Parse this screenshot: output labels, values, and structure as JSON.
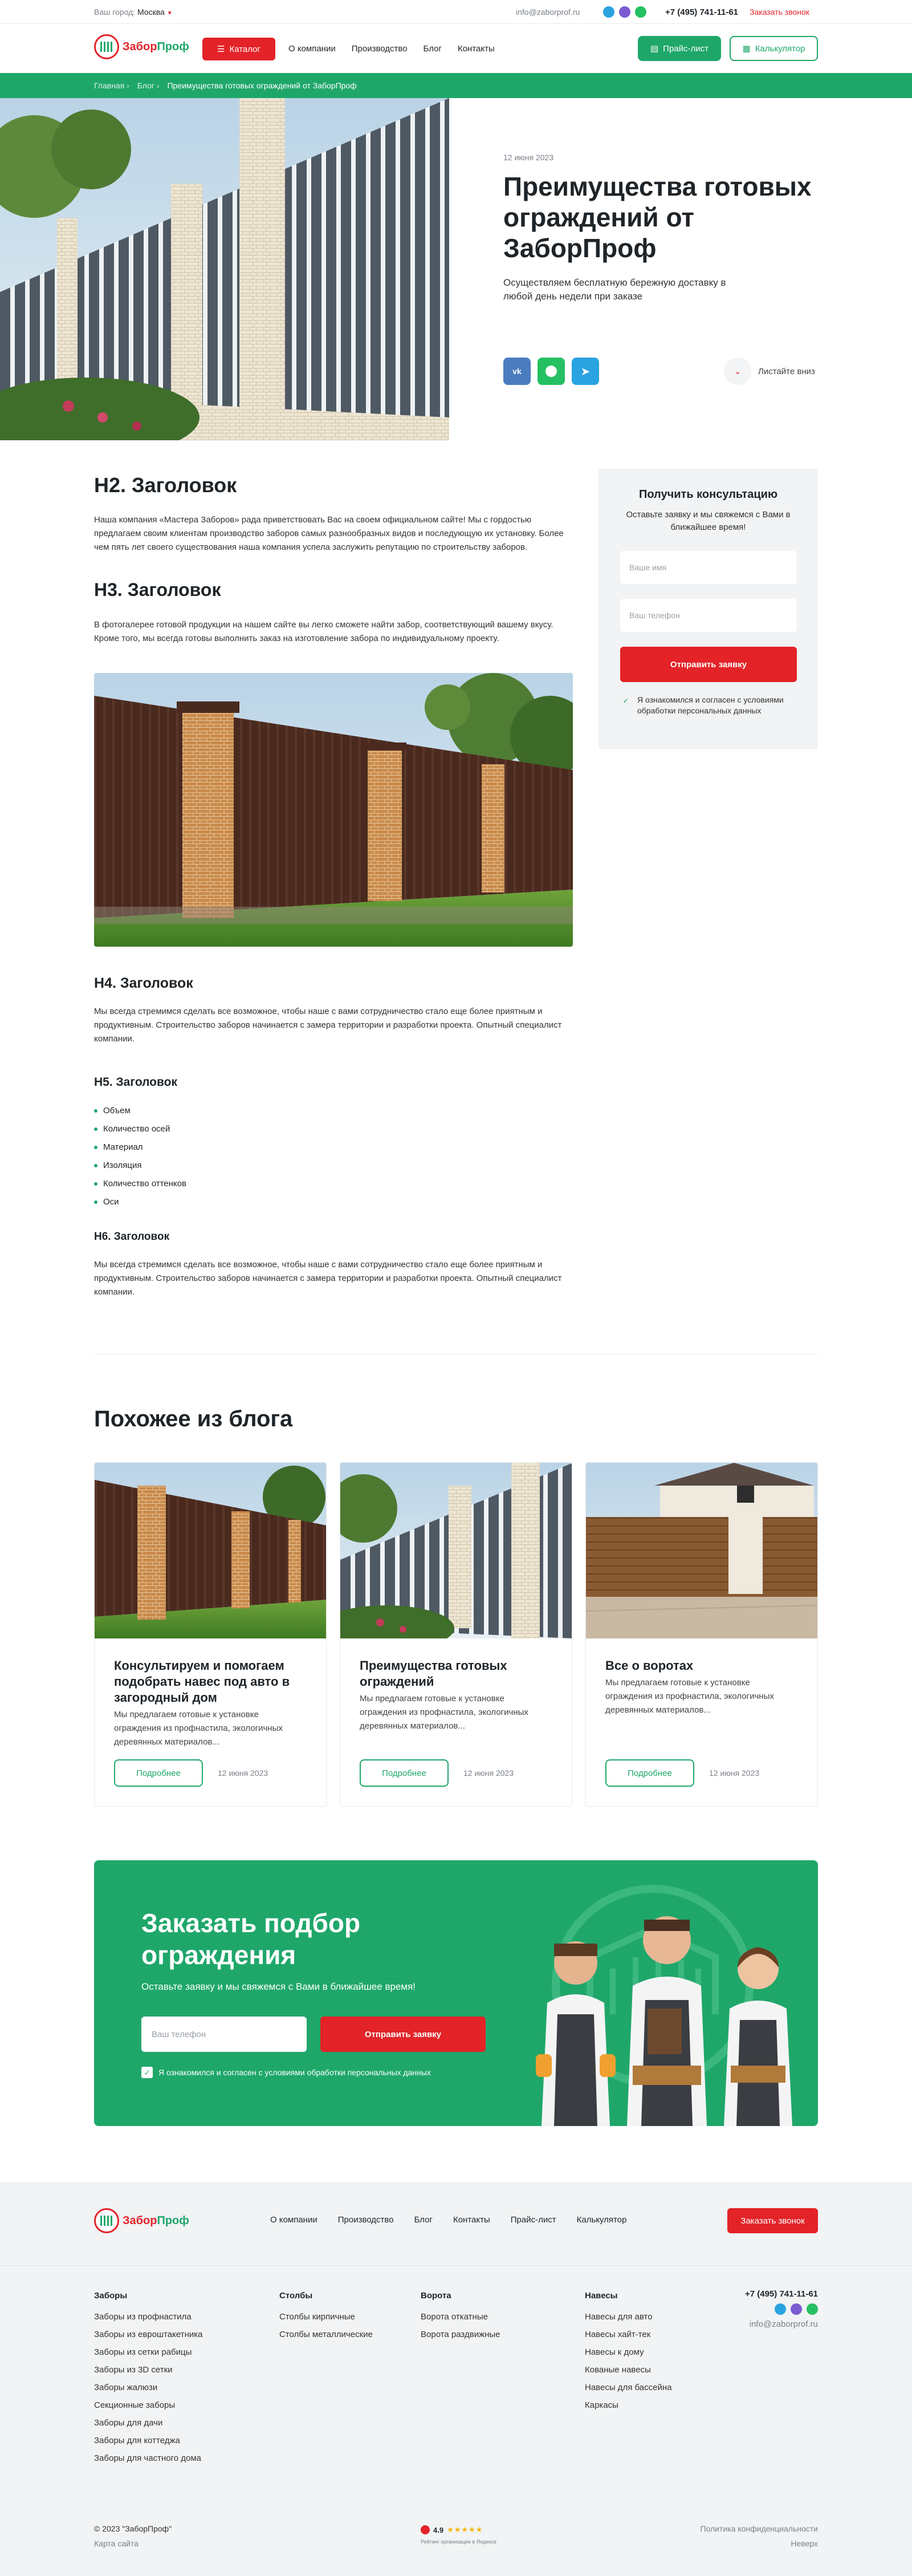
{
  "colors": {
    "brand_green": "#1fa76a",
    "brand_red": "#e32328",
    "footer_bg": "#f1f3f4"
  },
  "topbar": {
    "city_label": "Ваш город:",
    "city": "Москва",
    "email": "info@zaborprof.ru",
    "phone": "+7 (495) 741-11-61",
    "callback": "Заказать звонок"
  },
  "header": {
    "logo_a": "Забор",
    "logo_b": "Проф",
    "catalog": "Каталог",
    "nav": [
      "О компании",
      "Производство",
      "Блог",
      "Контакты"
    ],
    "price_list": "Прайс-лист",
    "calculator": "Калькулятор"
  },
  "breadcrumbs": [
    "Главная",
    "Блог",
    "Преимущества готовых ограждений от ЗаборПроф"
  ],
  "hero": {
    "date": "12 июня 2023",
    "title": "Преимущества готовых ограждений от ЗаборПроф",
    "subtitle": "Осуществляем бесплатную бережную доставку в любой день недели при заказе",
    "scroll": "Листайте вниз"
  },
  "article": {
    "h2": "H2. Заголовок",
    "p1": "Наша компания «Мастера Заборов» рада приветствовать Вас на своем официальном сайте! Мы с гордостью предлагаем своим клиентам производство заборов самых разнообразных видов и последующую их установку. Более чем пять лет своего существования наша компания успела заслужить репутацию по строительству заборов.",
    "h3": "H3. Заголовок",
    "p2": "В фотогалерее готовой продукции на нашем сайте вы легко сможете найти забор, соответствующий вашему вкусу. Кроме того, мы всегда готовы выполнить заказ на изготовление забора по индивидуальному проекту.",
    "h4": "H4. Заголовок",
    "p3": "Мы всегда стремимся сделать все возможное, чтобы наше с вами сотрудничество стало еще более приятным и продуктивным. Строительство заборов начинается с замера территории и разработки проекта. Опытный специалист компании.",
    "h5": "H5. Заголовок",
    "list": [
      "Объем",
      "Количество осей",
      "Материал",
      "Изоляция",
      "Количество оттенков",
      "Оси"
    ],
    "h6": "H6. Заголовок",
    "p4": "Мы всегда стремимся сделать все возможное, чтобы наше с вами сотрудничество стало еще более приятным и продуктивным. Строительство заборов начинается с замера территории и разработки проекта. Опытный специалист компании."
  },
  "consult": {
    "title": "Получить консультацию",
    "subtitle": "Оставьте заявку и мы свяжемся с Вами в ближайшее время!",
    "name_placeholder": "Ваше имя",
    "phone_placeholder": "Ваш телефон",
    "submit": "Отправить заявку",
    "consent": "Я ознакомился и согласен с условиями обработки персональных данных"
  },
  "blog": {
    "title": "Похожее из блога",
    "more": "Подробнее",
    "cards": [
      {
        "title": "Консультируем и помогаем подобрать навес под авто в загородный дом",
        "desc": "Мы предлагаем готовые к установке ограждения из профнастила, экологичных деревянных материалов...",
        "date": "12 июня 2023"
      },
      {
        "title": "Преимущества готовых ограждений",
        "desc": "Мы предлагаем готовые к установке ограждения из профнастила, экологичных деревянных материалов...",
        "date": "12 июня 2023"
      },
      {
        "title": "Все о воротах",
        "desc": "Мы предлагаем готовые к установке ограждения из профнастила, экологичных деревянных материалов...",
        "date": "12 июня 2023"
      }
    ]
  },
  "cta": {
    "title": "Заказать подбор ограждения",
    "subtitle": "Оставьте заявку и мы свяжемся с Вами в ближайшее время!",
    "phone_placeholder": "Ваш телефон",
    "submit": "Отправить заявку",
    "consent": "Я ознакомился и согласен с условиями обработки персональных данных"
  },
  "footer": {
    "nav": [
      "О компании",
      "Производство",
      "Блог",
      "Контакты",
      "Прайс-лист",
      "Калькулятор"
    ],
    "callback": "Заказать звонок",
    "cols": [
      {
        "title": "Заборы",
        "items": [
          "Заборы из профнастила",
          "Заборы из евроштакетника",
          "Заборы из сетки рабицы",
          "Заборы из 3D сетки",
          "Заборы жалюзи",
          "Секционные заборы",
          "Заборы для дачи",
          "Заборы для коттеджа",
          "Заборы для частного дома"
        ]
      },
      {
        "title": "Столбы",
        "items": [
          "Столбы кирпичные",
          "Столбы металлические"
        ]
      },
      {
        "title": "Ворота",
        "items": [
          "Ворота откатные",
          "Ворота раздвижные"
        ]
      },
      {
        "title": "Навесы",
        "items": [
          "Навесы для авто",
          "Навесы хайт-тек",
          "Навесы к дому",
          "Кованые навесы",
          "Навесы для бассейна",
          "Каркасы"
        ]
      }
    ],
    "phone": "+7 (495) 741-11-61",
    "email": "info@zaborprof.ru",
    "copyright": "© 2023 \"ЗаборПроф\"",
    "sitemap": "Карта сайта",
    "rating": "4.9",
    "rating_caption": "Рейтинг организации в Яндексе",
    "privacy": "Политика конфиденциальности",
    "dev": "Неверх"
  }
}
